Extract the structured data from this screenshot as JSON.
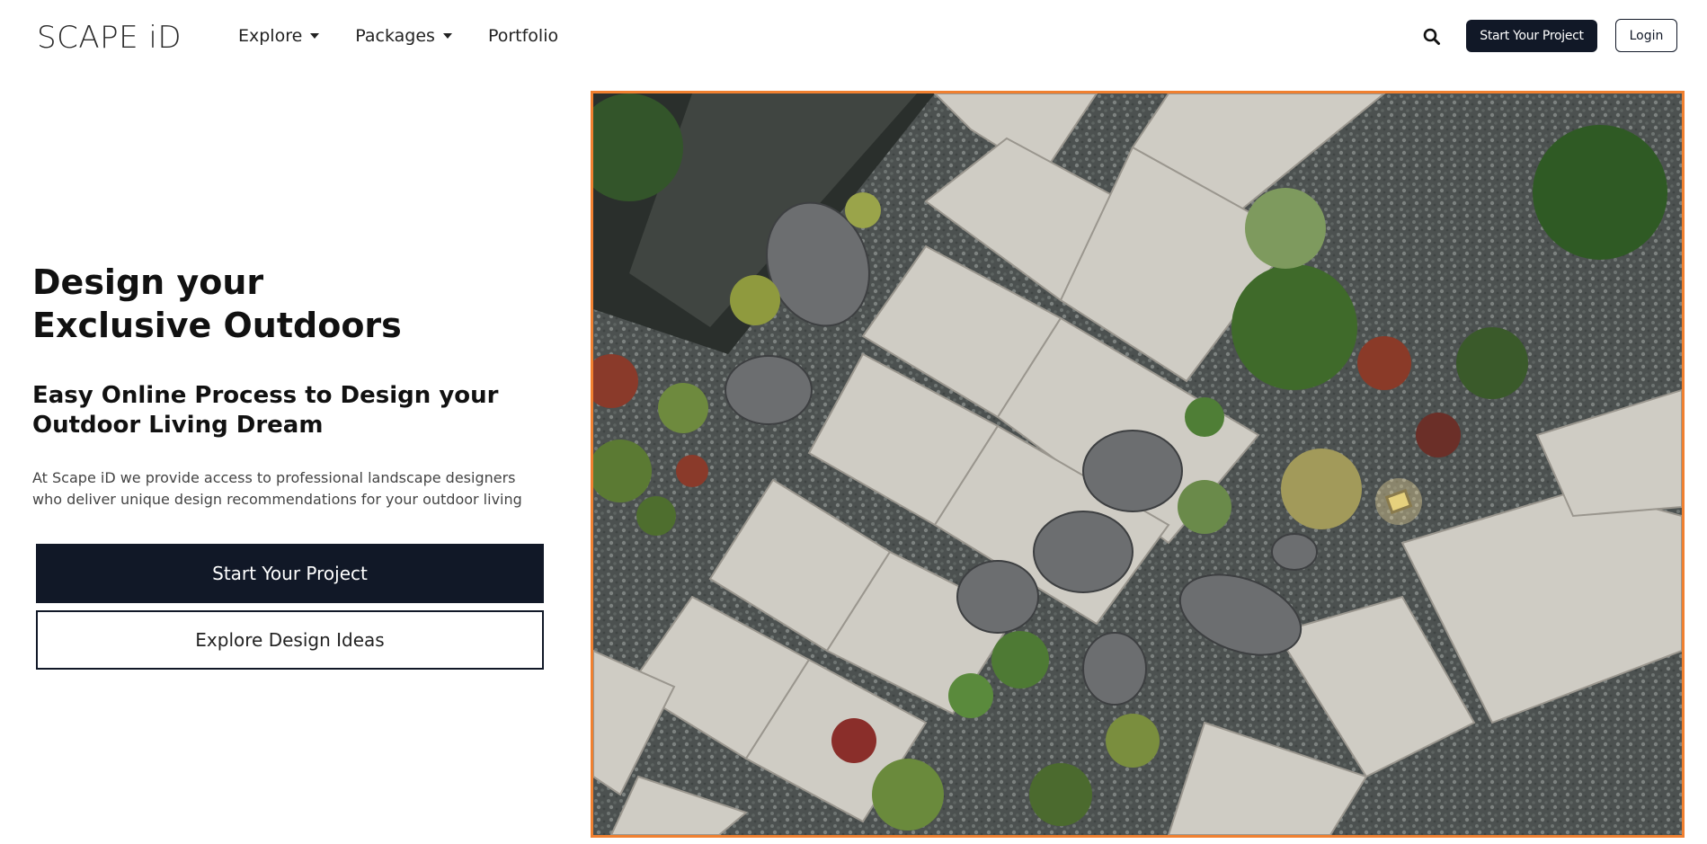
{
  "nav": {
    "logo": "SCAPE iD",
    "menu": [
      {
        "label": "Explore",
        "has_dropdown": true
      },
      {
        "label": "Packages",
        "has_dropdown": true
      },
      {
        "label": "Portfolio",
        "has_dropdown": false
      }
    ],
    "search_icon": "search-icon",
    "start_button": "Start Your Project",
    "login_button": "Login"
  },
  "hero": {
    "headline_line1": "Design your",
    "headline_line2": "Exclusive Outdoors",
    "subhead_line1": "Easy Online Process to Design your",
    "subhead_line2": "Outdoor Living Dream",
    "description": "At Scape iD we provide access to professional landscape designers who deliver unique design recommendations for your outdoor living",
    "primary_button": "Start Your Project",
    "secondary_button": "Explore Design Ideas"
  },
  "colors": {
    "accent_dark": "#111827",
    "image_border": "#f08030"
  }
}
